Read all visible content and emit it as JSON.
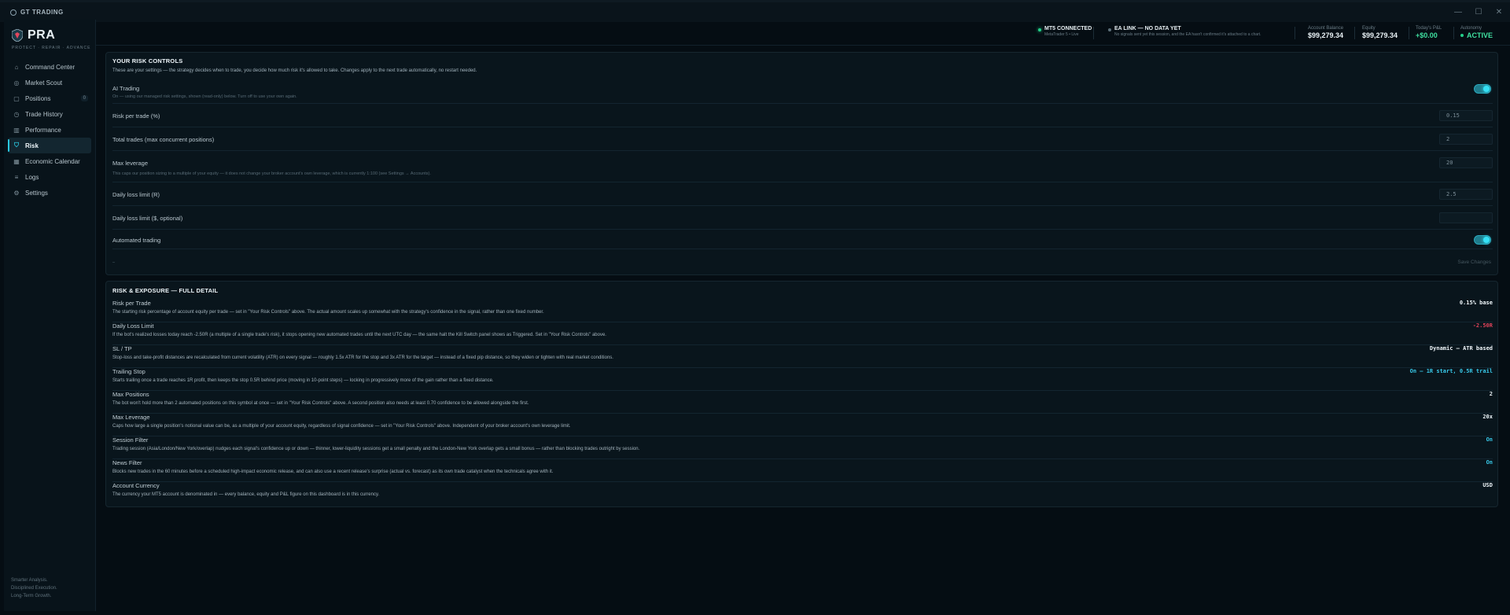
{
  "app": {
    "title": "GT TRADING"
  },
  "window_controls": [
    "—",
    "☐",
    "✕"
  ],
  "brand": {
    "name": "PRA",
    "tagline": "PROTECT · REPAIR · ADVANCE"
  },
  "nav": [
    {
      "label": "Command Center",
      "icon": "home-icon",
      "glyph": "⌂"
    },
    {
      "label": "Market Scout",
      "icon": "compass-icon",
      "glyph": "◎"
    },
    {
      "label": "Positions",
      "icon": "lock-icon",
      "glyph": "▢",
      "count": "0"
    },
    {
      "label": "Trade History",
      "icon": "clock-icon",
      "glyph": "◷"
    },
    {
      "label": "Performance",
      "icon": "bar-chart-icon",
      "glyph": "▥"
    },
    {
      "label": "Risk",
      "icon": "shield-icon",
      "glyph": "⛉",
      "active": true
    },
    {
      "label": "Economic Calendar",
      "icon": "calendar-icon",
      "glyph": "▦"
    },
    {
      "label": "Logs",
      "icon": "list-icon",
      "glyph": "≡"
    },
    {
      "label": "Settings",
      "icon": "gear-icon",
      "glyph": "⚙"
    }
  ],
  "sidebar_footer": [
    "Smarter Analysis.",
    "Disciplined Execution.",
    "Long-Term Growth."
  ],
  "header": {
    "mt5": {
      "title": "MT5 CONNECTED",
      "sub": "MetaTrader 5 • Live"
    },
    "ea": {
      "title": "EA LINK — NO DATA YET",
      "sub": "No signals sent yet this session, and the EA hasn't confirmed it's attached to a chart."
    },
    "account_balance": {
      "label": "Account Balance",
      "value": "$99,279.34"
    },
    "equity": {
      "label": "Equity",
      "value": "$99,279.34"
    },
    "todays_pnl": {
      "label": "Today's P&L",
      "value": "+$0.00"
    },
    "autonomy": {
      "label": "Autonomy",
      "value": "ACTIVE"
    },
    "colors": {
      "connected": "#22d08a",
      "pnl": "#3fe0a0",
      "accent": "#29c8e0"
    }
  },
  "risk_controls": {
    "title": "YOUR RISK CONTROLS",
    "subtitle": "These are your settings — the strategy decides when to trade, you decide how much risk it's allowed to take. Changes apply to the next trade automatically, no restart needed.",
    "ai_trading": {
      "label": "AI Trading",
      "note": "On — using our managed risk settings, shown (read-only) below. Turn off to use your own again.",
      "on": true
    },
    "risk_per_trade": {
      "label": "Risk per trade (%)",
      "value": "0.15"
    },
    "total_trades": {
      "label": "Total trades (max concurrent positions)",
      "value": "2"
    },
    "max_leverage": {
      "label": "Max leverage",
      "value": "20",
      "note": "This caps our position sizing to a multiple of your equity — it does not change your broker account's own leverage, which is currently 1:100 (see Settings → Accounts)."
    },
    "daily_loss_r": {
      "label": "Daily loss limit (R)",
      "value": "2.5"
    },
    "daily_loss_usd": {
      "label": "Daily loss limit ($, optional)",
      "value": ""
    },
    "automated_trading": {
      "label": "Automated trading",
      "on": true
    },
    "footer_dash": "–",
    "save_label": "Save Changes"
  },
  "exposure": {
    "title": "RISK & EXPOSURE — FULL DETAIL",
    "items": [
      {
        "title": "Risk per Trade",
        "desc": "The starting risk percentage of account equity per trade — set in \"Your Risk Controls\" above. The actual amount scales up somewhat with the strategy's confidence in the signal, rather than one fixed number.",
        "value": "0.15% base",
        "color": "#eef5f9"
      },
      {
        "title": "Daily Loss Limit",
        "desc": "If the bot's realized losses today reach -2.50R (a multiple of a single trade's risk), it stops opening new automated trades until the next UTC day — the same halt the Kill Switch panel shows as Triggered. Set in \"Your Risk Controls\" above.",
        "value": "-2.50R",
        "color": "#e0435a"
      },
      {
        "title": "SL / TP",
        "desc": "Stop-loss and take-profit distances are recalculated from current volatility (ATR) on every signal — roughly 1.5x ATR for the stop and 3x ATR for the target — instead of a fixed pip distance, so they widen or tighten with real market conditions.",
        "value": "Dynamic — ATR based",
        "color": "#eef5f9"
      },
      {
        "title": "Trailing Stop",
        "desc": "Starts trailing once a trade reaches 1R profit, then keeps the stop 0.5R behind price (moving in 10-point steps) — locking in progressively more of the gain rather than a fixed distance.",
        "value": "On — 1R start, 0.5R trail",
        "color": "#38c8e8"
      },
      {
        "title": "Max Positions",
        "desc": "The bot won't hold more than 2 automated positions on this symbol at once — set in \"Your Risk Controls\" above. A second position also needs at least 0.70 confidence to be allowed alongside the first.",
        "value": "2",
        "color": "#eef5f9"
      },
      {
        "title": "Max Leverage",
        "desc": "Caps how large a single position's notional value can be, as a multiple of your account equity, regardless of signal confidence — set in \"Your Risk Controls\" above. Independent of your broker account's own leverage limit.",
        "value": "20x",
        "color": "#eef5f9"
      },
      {
        "title": "Session Filter",
        "desc": "Trading session (Asia/London/New York/overlap) nudges each signal's confidence up or down — thinner, lower-liquidity sessions get a small penalty and the London-New York overlap gets a small bonus — rather than blocking trades outright by session.",
        "value": "On",
        "color": "#38c8e8"
      },
      {
        "title": "News Filter",
        "desc": "Blocks new trades in the 60 minutes before a scheduled high-impact economic release, and can also use a recent release's surprise (actual vs. forecast) as its own trade catalyst when the technicals agree with it.",
        "value": "On",
        "color": "#38c8e8"
      },
      {
        "title": "Account Currency",
        "desc": "The currency your MT5 account is denominated in — every balance, equity and P&L figure on this dashboard is in this currency.",
        "value": "USD",
        "color": "#eef5f9"
      }
    ]
  }
}
